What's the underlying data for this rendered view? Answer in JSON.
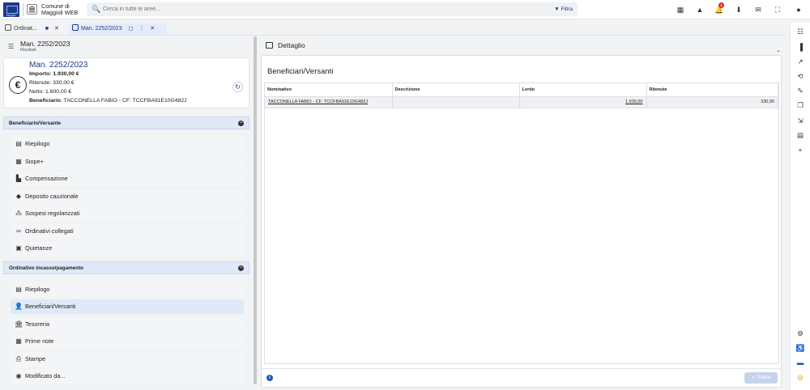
{
  "header": {
    "logo_text": "Maggioli",
    "app_title_line1": "Comune di",
    "app_title_line2": "Maggioli WEB",
    "search_placeholder": "Cerca in tutte le aree...",
    "filter_label": "Filtra",
    "notification_count": "1"
  },
  "tabs": [
    {
      "label": "Ordinat..."
    },
    {
      "label": "Man. 2252/2023"
    }
  ],
  "left": {
    "title": "Man. 2252/2023",
    "subtitle": "Risultati",
    "card": {
      "title": "Man. 2252/2023",
      "importo": "Importo: 1.930,00 €",
      "ritenute": "Ritenute: 330,00 €",
      "netto": "Netto: 1.600,00 €",
      "beneficiario_label": "Beneficiario",
      "beneficiario_value": ": TACCONELLA FABIO - CF: TCCFBA91E10G482J"
    },
    "section1": {
      "title": "Beneficiario/Versante",
      "items": [
        {
          "label": "Riepilogo",
          "icon": "report-icon"
        },
        {
          "label": "Siope+",
          "icon": "grid-icon"
        },
        {
          "label": "Compensazione",
          "icon": "document-icon"
        },
        {
          "label": "Deposito cauzionale",
          "icon": "piggy-bank-icon"
        },
        {
          "label": "Sospesi regolarizzati",
          "icon": "network-icon"
        },
        {
          "label": "Ordinativi collegati",
          "icon": "link-icon"
        },
        {
          "label": "Quietanze",
          "icon": "receipt-icon"
        }
      ]
    },
    "section2": {
      "title": "Ordinativo incasso/pagamento",
      "items": [
        {
          "label": "Riepilogo",
          "icon": "report-icon"
        },
        {
          "label": "Beneficiari/Versanti",
          "icon": "person-icon"
        },
        {
          "label": "Tesoreria",
          "icon": "bank-icon"
        },
        {
          "label": "Prime note",
          "icon": "grid-icon"
        },
        {
          "label": "Stampe",
          "icon": "printer-icon"
        },
        {
          "label": "Modificato da...",
          "icon": "database-icon"
        }
      ]
    }
  },
  "right": {
    "header_title": "Dettaglio",
    "section_title": "Beneficiari/Versanti",
    "columns": [
      "Nominativo",
      "Descrizione",
      "Lordo",
      "Ritenute"
    ],
    "rows": [
      [
        "TACCONELLA FABIO - CF: TCCFBA91E10G482J",
        "",
        "1.930,00",
        "330,00"
      ]
    ],
    "save_label": "Salva"
  },
  "colors": {
    "accent": "#1b3a8c",
    "section_bg": "#dfe9f7",
    "badge": "#d32f2f"
  }
}
